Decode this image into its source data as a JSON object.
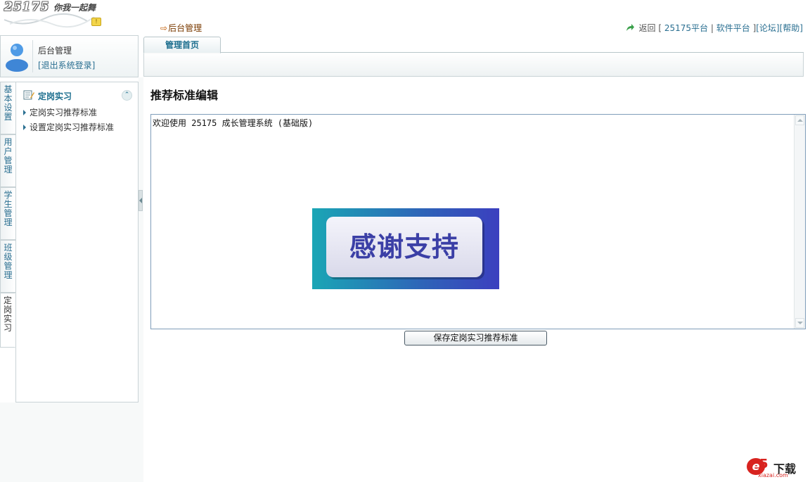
{
  "logo": {
    "number": "25175",
    "slogan": "你我一起舞"
  },
  "breadcrumb": {
    "label": "后台管理"
  },
  "toplinks": {
    "back": "返回",
    "open1": "[",
    "platform": "25175平台",
    "sep": "|",
    "software": "软件平台",
    "close1": "]",
    "forum": "[论坛]",
    "help": "[帮助]"
  },
  "user": {
    "name": "后台管理",
    "logout": "[退出系统登录]"
  },
  "tabs": [
    {
      "label": "管理首页"
    }
  ],
  "vtabs": [
    {
      "label": "基本设置"
    },
    {
      "label": "用户管理"
    },
    {
      "label": "学生管理"
    },
    {
      "label": "班级管理"
    },
    {
      "label": "定岗实习"
    }
  ],
  "menu": {
    "title": "定岗实习",
    "items": [
      {
        "label": "定岗实习推荐标准"
      },
      {
        "label": "设置定岗实习推荐标准"
      }
    ]
  },
  "content": {
    "heading": "推荐标准编辑",
    "editor_text": "欢迎使用 25175 成长管理系统 (基础版)",
    "image_text": "感谢支持",
    "save_button": "保存定岗实习推荐标准"
  },
  "watermark": {
    "brand": "5",
    "label": "下载",
    "site": "xiazai.com"
  },
  "colors": {
    "accent": "#2a6f91",
    "tab_text": "#1e6f8f",
    "brand_red": "#d8231f"
  }
}
